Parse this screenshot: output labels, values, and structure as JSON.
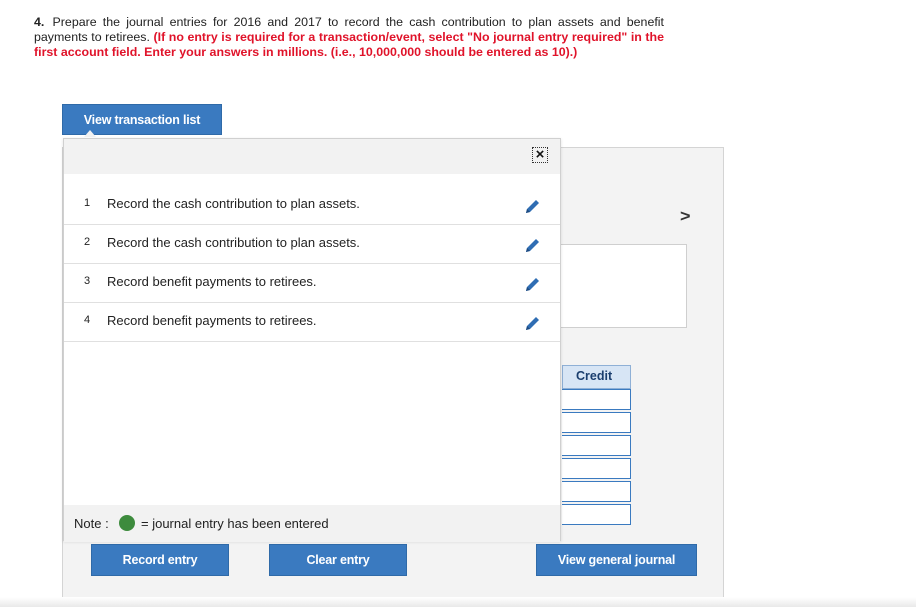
{
  "instructions": {
    "number": "4.",
    "text": "Prepare the journal entries for 2016 and 2017 to record the cash contribution to plan assets and benefit payments to retirees.",
    "note": "(If no entry is required for a transaction/event, select \"No journal entry required\" in the first account field. Enter your answers in millions. (i.e., 10,000,000 should be entered as 10).)"
  },
  "buttons": {
    "view_transaction_list": "View transaction list",
    "record_entry": "Record entry",
    "clear_entry": "Clear entry",
    "view_general_journal": "View general journal"
  },
  "journal": {
    "credit_header": "Credit",
    "next_icon": "chevron-right-icon"
  },
  "transactions": [
    {
      "index": "1",
      "description": "Record the cash contribution to plan assets."
    },
    {
      "index": "2",
      "description": "Record the cash contribution to plan assets."
    },
    {
      "index": "3",
      "description": "Record benefit payments to retirees."
    },
    {
      "index": "4",
      "description": "Record benefit payments to retirees."
    }
  ],
  "note": {
    "label": "Note :",
    "text": "= journal entry has been entered"
  },
  "colors": {
    "accent": "#3a7ac0",
    "instruction_red": "#e0132a",
    "entered_dot": "#3d8b3d"
  }
}
